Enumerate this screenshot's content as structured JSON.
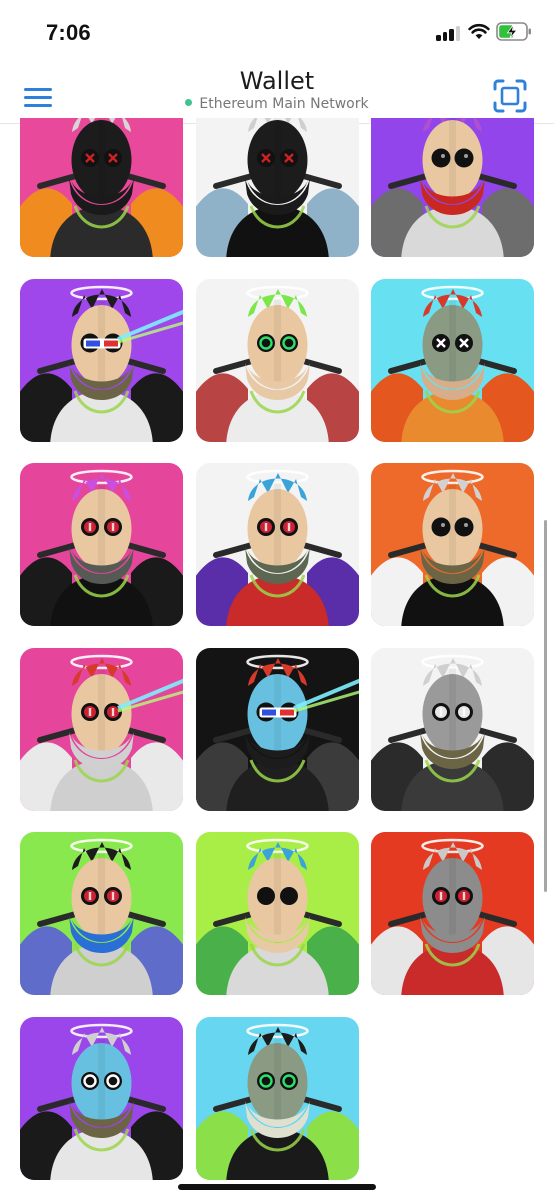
{
  "status_bar": {
    "time": "7:06",
    "signal_bars": 3,
    "battery_level": 0.55,
    "battery_charging": true
  },
  "header": {
    "title": "Wallet",
    "network": "Ethereum Main Network",
    "network_status_color": "#3fc28f",
    "accent": "#2f80d8",
    "menu_icon": "hamburger-menu-icon",
    "scan_icon": "scan-frame-icon"
  },
  "collection": {
    "columns": 3,
    "items": [
      {
        "bg": "#e9499a",
        "skin": "#1c1c1c",
        "hair": "#d6d6d6",
        "mask": "#1a1a1a",
        "eyes": "cross",
        "eye_color": "#cc2222",
        "jacket": "#2b2b2b",
        "wings": "#f08b1f",
        "glasses": false,
        "laser": false
      },
      {
        "bg": "#f3f3f3",
        "skin": "#1c1c1c",
        "hair": "#cfcfcf",
        "mask": "#1a1a1a",
        "eyes": "cross",
        "eye_color": "#cc2222",
        "jacket": "#111111",
        "wings": "#8fb2c8",
        "glasses": false,
        "laser": false
      },
      {
        "bg": "#9145ea",
        "skin": "#e9c7a1",
        "hair": "#b04fd0",
        "mask": "#c8281f",
        "eyes": "dot",
        "eye_color": "#111111",
        "jacket": "#d9d9d9",
        "wings": "#6d6d6d",
        "glasses": false,
        "laser": false
      },
      {
        "bg": "#a047ec",
        "skin": "#e9c7a1",
        "hair": "#1c1c1c",
        "mask": "#6b6545",
        "eyes": "dot",
        "eye_color": "#111111",
        "jacket": "#e6e6e6",
        "wings": "#1a1a1a",
        "glasses": true,
        "laser": true
      },
      {
        "bg": "#f3f3f3",
        "skin": "#e9c7a1",
        "hair": "#7ce64a",
        "mask": "#e8c9a6",
        "eyes": "ring",
        "eye_color": "#2ce06a",
        "jacket": "#ececec",
        "wings": "#b94444",
        "glasses": false,
        "laser": false
      },
      {
        "bg": "#67e1f2",
        "skin": "#8a9a83",
        "hair": "#d63a2a",
        "mask": "#d7ad8a",
        "eyes": "cross",
        "eye_color": "#ffffff",
        "jacket": "#e88a2d",
        "wings": "#e4571f",
        "glasses": false,
        "laser": false
      },
      {
        "bg": "#e5469b",
        "skin": "#e9c7a1",
        "hair": "#c84fe0",
        "mask": "#555a55",
        "eyes": "coin",
        "eye_color": "#cc2233",
        "jacket": "#111111",
        "wings": "#1a1a1a",
        "glasses": false,
        "laser": false
      },
      {
        "bg": "#f3f3f3",
        "skin": "#e9c7a1",
        "hair": "#3aa4d8",
        "mask": "#5d6650",
        "eyes": "coin",
        "eye_color": "#cc2233",
        "jacket": "#c92a2a",
        "wings": "#5a2ea8",
        "glasses": false,
        "laser": false
      },
      {
        "bg": "#ee6a2a",
        "skin": "#e9c7a1",
        "hair": "#d1d1d1",
        "mask": "#6b6545",
        "eyes": "dot",
        "eye_color": "#111111",
        "jacket": "#111111",
        "wings": "#f2f2f2",
        "glasses": false,
        "laser": false
      },
      {
        "bg": "#e5469b",
        "skin": "#e9c7a1",
        "hair": "#d63a2a",
        "mask": "#d0d0d0",
        "eyes": "coin",
        "eye_color": "#cc2233",
        "jacket": "#cfcfcf",
        "wings": "#e9e9e9",
        "glasses": false,
        "laser": true
      },
      {
        "bg": "#141414",
        "skin": "#67c0e0",
        "hair": "#d63a2a",
        "mask": "#1c1c1c",
        "eyes": "dot",
        "eye_color": "#111111",
        "jacket": "#1f1f1f",
        "wings": "#3b3b3b",
        "glasses": true,
        "laser": true
      },
      {
        "bg": "#f3f3f3",
        "skin": "#9a9a9a",
        "hair": "#cfcfcf",
        "mask": "#6b6545",
        "eyes": "coin",
        "eye_color": "#e6e6e6",
        "jacket": "#3a3a3a",
        "wings": "#2b2b2b",
        "glasses": false,
        "laser": false
      },
      {
        "bg": "#8ae84f",
        "skin": "#e9c7a1",
        "hair": "#1c1c1c",
        "mask": "#2a6fd6",
        "eyes": "coin",
        "eye_color": "#cc2233",
        "jacket": "#cfcfcf",
        "wings": "#5f6cc9",
        "glasses": false,
        "laser": false
      },
      {
        "bg": "#a8ee46",
        "skin": "#e9c7a1",
        "hair": "#3aa4d8",
        "mask": "#e8c9a6",
        "eyes": "cross",
        "eye_color": "#111111",
        "jacket": "#d9d9d9",
        "wings": "#4ab04a",
        "glasses": false,
        "laser": false
      },
      {
        "bg": "#e43a22",
        "skin": "#8c8c8c",
        "hair": "#c9c9c9",
        "mask": "#8c8c8c",
        "eyes": "coin",
        "eye_color": "#cc2233",
        "jacket": "#c92a2a",
        "wings": "#e6e6e6",
        "glasses": false,
        "laser": false
      },
      {
        "bg": "#9b46ea",
        "skin": "#67c0e0",
        "hair": "#cfcfcf",
        "mask": "#6b6545",
        "eyes": "ring",
        "eye_color": "#ffffff",
        "jacket": "#e6e6e6",
        "wings": "#1a1a1a",
        "glasses": false,
        "laser": false
      },
      {
        "bg": "#67d6f0",
        "skin": "#8a9a83",
        "hair": "#1c1c1c",
        "mask": "#e0e0d0",
        "eyes": "ring",
        "eye_color": "#2ce06a",
        "jacket": "#1a1a1a",
        "wings": "#8be04a",
        "glasses": false,
        "laser": false
      }
    ]
  }
}
